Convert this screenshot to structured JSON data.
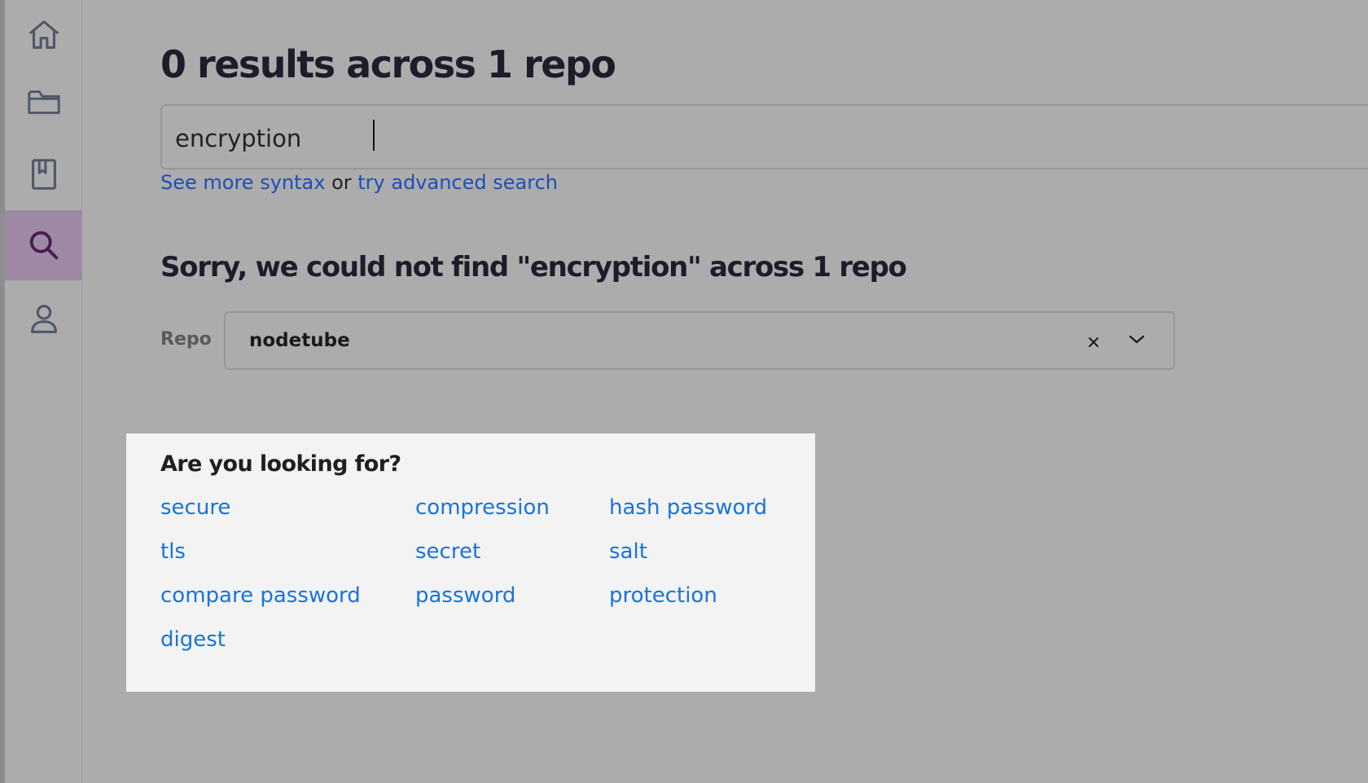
{
  "sidebar": {
    "items": [
      {
        "icon": "home-icon",
        "active": false
      },
      {
        "icon": "folder-icon",
        "active": false
      },
      {
        "icon": "bookmark-icon",
        "active": false
      },
      {
        "icon": "search-icon",
        "active": true
      },
      {
        "icon": "user-icon",
        "active": false
      }
    ]
  },
  "header": {
    "title": "0 results across 1 repo"
  },
  "search": {
    "value": "encryption"
  },
  "syntax": {
    "more_syntax_link": "See more syntax",
    "or_text": " or ",
    "advanced_link": "try advanced search"
  },
  "results": {
    "sorry_message": "Sorry, we could not find \"encryption\" across 1 repo"
  },
  "repo_filter": {
    "label": "Repo",
    "value": "nodetube"
  },
  "suggestions": {
    "title": "Are you looking for?",
    "items": [
      "secure",
      "compression",
      "hash password",
      "tls",
      "secret",
      "salt",
      "compare password",
      "password",
      "protection",
      "digest"
    ]
  },
  "colors": {
    "link": "#1a73d9",
    "syntax_link": "#1d4fb5",
    "active_nav": "#9d89a4",
    "overlay_bg": "#acacac",
    "panel_bg": "#f3f3f3"
  }
}
